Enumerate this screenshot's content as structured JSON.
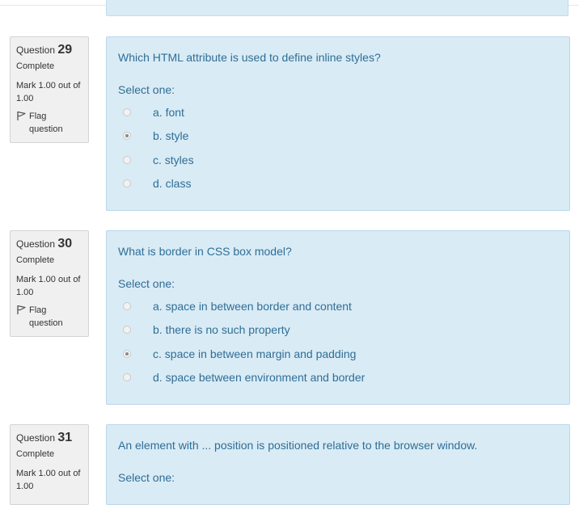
{
  "questions": [
    {
      "label": "Question",
      "number": "29",
      "state": "Complete",
      "grade": "Mark 1.00 out of 1.00",
      "flag_label": "Flag question",
      "text": "Which HTML attribute is used to define inline styles?",
      "prompt": "Select one:",
      "answers": [
        {
          "text": "a. font",
          "checked": false
        },
        {
          "text": "b. style",
          "checked": true
        },
        {
          "text": "c. styles",
          "checked": false
        },
        {
          "text": "d. class",
          "checked": false
        }
      ]
    },
    {
      "label": "Question",
      "number": "30",
      "state": "Complete",
      "grade": "Mark 1.00 out of 1.00",
      "flag_label": "Flag question",
      "text": "What is border in CSS box model?",
      "prompt": "Select one:",
      "answers": [
        {
          "text": "a. space in between border and content",
          "checked": false
        },
        {
          "text": "b. there is no such property",
          "checked": false
        },
        {
          "text": "c. space in between margin and padding",
          "checked": true
        },
        {
          "text": "d. space between environment and border",
          "checked": false
        }
      ]
    },
    {
      "label": "Question",
      "number": "31",
      "state": "Complete",
      "grade": "Mark 1.00 out of 1.00",
      "text": "An element with ... position is positioned relative to the browser window.",
      "prompt": "Select one:"
    }
  ],
  "colors": {
    "content_bg": "#d9ebf5",
    "content_text": "#2f6e96",
    "info_bg": "#f0f0f0"
  },
  "icons": {
    "flag": "flag-icon"
  }
}
